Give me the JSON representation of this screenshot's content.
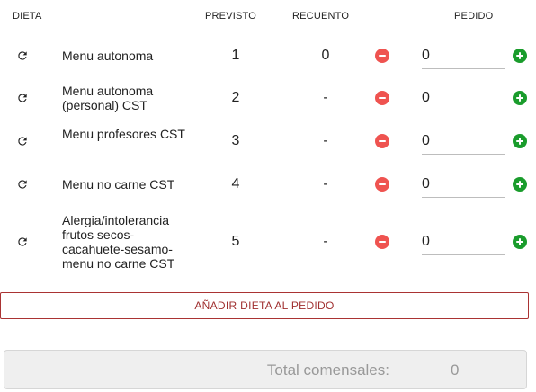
{
  "headers": {
    "dieta": "DIETA",
    "previsto": "PREVISTO",
    "recuento": "RECUENTO",
    "pedido": "PEDIDO"
  },
  "rows": [
    {
      "name": "Menu autonoma",
      "previsto": "1",
      "recuento": "0",
      "pedido": "0"
    },
    {
      "name": "Menu autonoma (personal) CST",
      "previsto": "2",
      "recuento": "-",
      "pedido": "0"
    },
    {
      "name": "Menu profesores CST",
      "previsto": "3",
      "recuento": "-",
      "pedido": "0"
    },
    {
      "name": "Menu no carne CST",
      "previsto": "4",
      "recuento": "-",
      "pedido": "0"
    },
    {
      "name": "Alergia/intolerancia frutos secos-cacahuete-sesamo-menu no carne CST",
      "previsto": "5",
      "recuento": "-",
      "pedido": "0"
    }
  ],
  "add_button_label": "AÑADIR DIETA AL PEDIDO",
  "total": {
    "label": "Total comensales:",
    "value": "0"
  },
  "colors": {
    "minus": "#ef5350",
    "plus": "#1a9c2c",
    "accent": "#a03030"
  },
  "icons": {
    "refresh": "refresh-icon",
    "minus": "minus-circle-icon",
    "plus": "plus-circle-icon"
  }
}
